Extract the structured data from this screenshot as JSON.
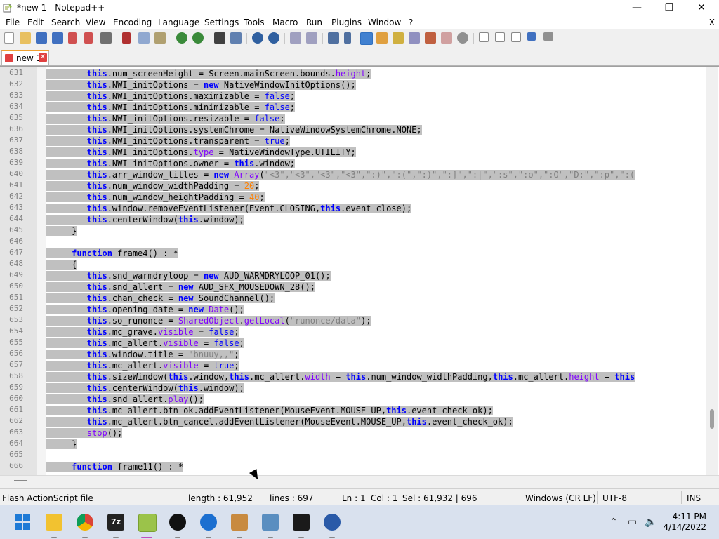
{
  "window": {
    "title": "*new 1 - Notepad++",
    "minimize": "—",
    "maximize": "❐",
    "close": "✕"
  },
  "menu": [
    "File",
    "Edit",
    "Search",
    "View",
    "Encoding",
    "Language",
    "Settings",
    "Tools",
    "Macro",
    "Run",
    "Plugins",
    "Window",
    "?"
  ],
  "menu_close": "X",
  "tab": {
    "label": "new 1",
    "close": "✕"
  },
  "lines": [
    {
      "n": "631",
      "html": "        <span class=\"kwb\">this</span>.num_screenHeight = Screen.mainScreen.bounds.<span class=\"prop\">height</span>;"
    },
    {
      "n": "632",
      "html": "        <span class=\"kwb\">this</span>.NWI_initOptions = <span class=\"kwb\">new</span> NativeWindowInitOptions();"
    },
    {
      "n": "633",
      "html": "        <span class=\"kwb\">this</span>.NWI_initOptions.maximizable = <span class=\"kw\">false</span>;"
    },
    {
      "n": "634",
      "html": "        <span class=\"kwb\">this</span>.NWI_initOptions.minimizable = <span class=\"kw\">false</span>;"
    },
    {
      "n": "635",
      "html": "        <span class=\"kwb\">this</span>.NWI_initOptions.resizable = <span class=\"kw\">false</span>;"
    },
    {
      "n": "636",
      "html": "        <span class=\"kwb\">this</span>.NWI_initOptions.systemChrome = NativeWindowSystemChrome.NONE;"
    },
    {
      "n": "637",
      "html": "        <span class=\"kwb\">this</span>.NWI_initOptions.transparent = <span class=\"kw\">true</span>;"
    },
    {
      "n": "638",
      "html": "        <span class=\"kwb\">this</span>.NWI_initOptions.<span class=\"prop\">type</span> = NativeWindowType.UTILITY;"
    },
    {
      "n": "639",
      "html": "        <span class=\"kwb\">this</span>.NWI_initOptions.owner = <span class=\"kwb\">this</span>.window;"
    },
    {
      "n": "640",
      "html": "        <span class=\"kwb\">this</span>.arr_window_titles = <span class=\"kwb\">new</span> <span class=\"prop\">Array</span>(<span class=\"str\">\"&lt;3\",\"&lt;3\",\"&lt;3\",\"&lt;3\",\":)\",\":(\",\":)\",\":]\",\":|\",\":s\",\":o\",\":O\",\"D:\",\":p\",\":(</span>"
    },
    {
      "n": "641",
      "html": "        <span class=\"kwb\">this</span>.num_window_widthPadding = <span class=\"num\">20</span>;"
    },
    {
      "n": "642",
      "html": "        <span class=\"kwb\">this</span>.num_window_heightPadding = <span class=\"num\">40</span>;"
    },
    {
      "n": "643",
      "html": "        <span class=\"kwb\">this</span>.window.removeEventListener(Event.CLOSING,<span class=\"kwb\">this</span>.event_close);"
    },
    {
      "n": "644",
      "html": "        <span class=\"kwb\">this</span>.centerWindow(<span class=\"kwb\">this</span>.window);"
    },
    {
      "n": "645",
      "html": "     }"
    },
    {
      "n": "646",
      "html": ""
    },
    {
      "n": "647",
      "html": "     <span class=\"kwb\">function</span> frame4() : *"
    },
    {
      "n": "648",
      "html": "     {"
    },
    {
      "n": "649",
      "html": "        <span class=\"kwb\">this</span>.snd_warmdryloop = <span class=\"kwb\">new</span> AUD_WARMDRYLOOP_01();"
    },
    {
      "n": "650",
      "html": "        <span class=\"kwb\">this</span>.snd_allert = <span class=\"kwb\">new</span> AUD_SFX_MOUSEDOWN_28();"
    },
    {
      "n": "651",
      "html": "        <span class=\"kwb\">this</span>.chan_check = <span class=\"kwb\">new</span> SoundChannel();"
    },
    {
      "n": "652",
      "html": "        <span class=\"kwb\">this</span>.opening_date = <span class=\"kwb\">new</span> <span class=\"prop\">Date</span>();"
    },
    {
      "n": "653",
      "html": "        <span class=\"kwb\">this</span>.so_runonce = <span class=\"prop\">SharedObject</span>.<span class=\"prop\">getLocal</span>(<span class=\"str\">\"runonce/data\"</span>);"
    },
    {
      "n": "654",
      "html": "        <span class=\"kwb\">this</span>.mc_grave.<span class=\"prop\">visible</span> = <span class=\"kw\">false</span>;"
    },
    {
      "n": "655",
      "html": "        <span class=\"kwb\">this</span>.mc_allert.<span class=\"prop\">visible</span> = <span class=\"kw\">false</span>;"
    },
    {
      "n": "656",
      "html": "        <span class=\"kwb\">this</span>.window.title = <span class=\"str\">\"bnuuy,,\"</span>;"
    },
    {
      "n": "657",
      "html": "        <span class=\"kwb\">this</span>.mc_allert.<span class=\"prop\">visible</span> = <span class=\"kw\">true</span>;"
    },
    {
      "n": "658",
      "html": "        <span class=\"kwb\">this</span>.sizeWindow(<span class=\"kwb\">this</span>.window,<span class=\"kwb\">this</span>.mc_allert.<span class=\"prop\">width</span> + <span class=\"kwb\">this</span>.num_window_widthPadding,<span class=\"kwb\">this</span>.mc_allert.<span class=\"prop\">height</span> + <span class=\"kwb\">this</span>"
    },
    {
      "n": "659",
      "html": "        <span class=\"kwb\">this</span>.centerWindow(<span class=\"kwb\">this</span>.window);"
    },
    {
      "n": "660",
      "html": "        <span class=\"kwb\">this</span>.snd_allert.<span class=\"prop\">play</span>();"
    },
    {
      "n": "661",
      "html": "        <span class=\"kwb\">this</span>.mc_allert.btn_ok.addEventListener(MouseEvent.MOUSE_UP,<span class=\"kwb\">this</span>.event_check_ok);"
    },
    {
      "n": "662",
      "html": "        <span class=\"kwb\">this</span>.mc_allert.btn_cancel.addEventListener(MouseEvent.MOUSE_UP,<span class=\"kwb\">this</span>.event_check_ok);"
    },
    {
      "n": "663",
      "html": "        <span class=\"prop\">stop</span>();"
    },
    {
      "n": "664",
      "html": "     }"
    },
    {
      "n": "665",
      "html": ""
    },
    {
      "n": "666",
      "html": "     <span class=\"kwb\">function</span> frame11() : *"
    }
  ],
  "status": {
    "filetype": "Flash ActionScript file",
    "length": "length : 61,952",
    "lines": "lines : 697",
    "ln": "Ln : 1",
    "col": "Col : 1",
    "sel": "Sel : 61,932 | 696",
    "eol": "Windows (CR LF)",
    "encoding": "UTF-8",
    "mode": "INS"
  },
  "clock": {
    "time": "4:11 PM",
    "date": "4/14/2022"
  },
  "colors": {
    "selection": "#c0c0c0",
    "keyword": "#0000ff",
    "string": "#808080",
    "number": "#ff8000",
    "property": "#8000ff"
  }
}
